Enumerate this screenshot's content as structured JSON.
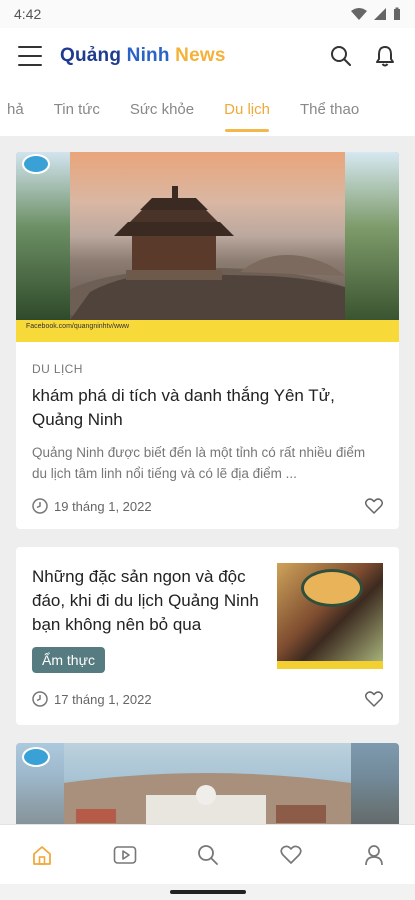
{
  "status": {
    "time": "4:42"
  },
  "app": {
    "brand_part1": "Quảng",
    "brand_part2": "Ninh",
    "brand_part3": "News",
    "colors": {
      "brand_dark": "#1f3b8f",
      "brand_blue": "#2b63c7",
      "brand_orange": "#f4b23a",
      "tab_active": "#f0a93a",
      "tag_bg": "#567b80"
    }
  },
  "tabs": [
    {
      "label": "hả"
    },
    {
      "label": "Tin tức"
    },
    {
      "label": "Sức khỏe"
    },
    {
      "label": "Du lịch",
      "active": true
    },
    {
      "label": "Thể thao"
    }
  ],
  "articles": [
    {
      "category": "DU LỊCH",
      "title": "khám phá di tích và danh thắng Yên Tử, Quảng Ninh",
      "summary": "Quảng Ninh được biết đến là một tỉnh có rất nhiều điểm du lịch tâm linh nổi tiếng và có lẽ địa điểm ...",
      "date": "19 tháng 1, 2022",
      "image_caption": "Facebook.com/quangninhtv/www"
    },
    {
      "title": "Những đặc sản ngon và độc đáo, khi đi du lịch Quảng Ninh bạn không nên bỏ qua",
      "tag": "Ẩm thực",
      "date": "17 tháng 1, 2022"
    }
  ],
  "bottom_nav": [
    {
      "icon": "home-icon",
      "active": true
    },
    {
      "icon": "video-icon"
    },
    {
      "icon": "search-icon"
    },
    {
      "icon": "heart-icon"
    },
    {
      "icon": "profile-icon"
    }
  ]
}
